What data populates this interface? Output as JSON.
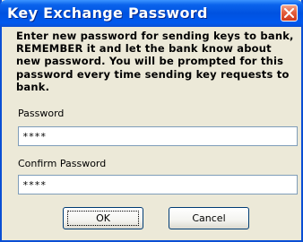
{
  "window": {
    "title": "Key Exchange Password"
  },
  "message": "Enter new password for sending keys to bank, REMEMBER it and let the bank know about new password. You will be prompted for this password every time sending key requests to bank.",
  "fields": {
    "password": {
      "label": "Password",
      "value": "****"
    },
    "confirm": {
      "label": "Confirm Password",
      "value": "****"
    }
  },
  "buttons": {
    "ok": "OK",
    "cancel": "Cancel"
  },
  "colors": {
    "titlebar": "#0052e0",
    "dialog_bg": "#ece9d8",
    "close_button": "#e5613f"
  },
  "icons": {
    "close": "close-icon"
  }
}
